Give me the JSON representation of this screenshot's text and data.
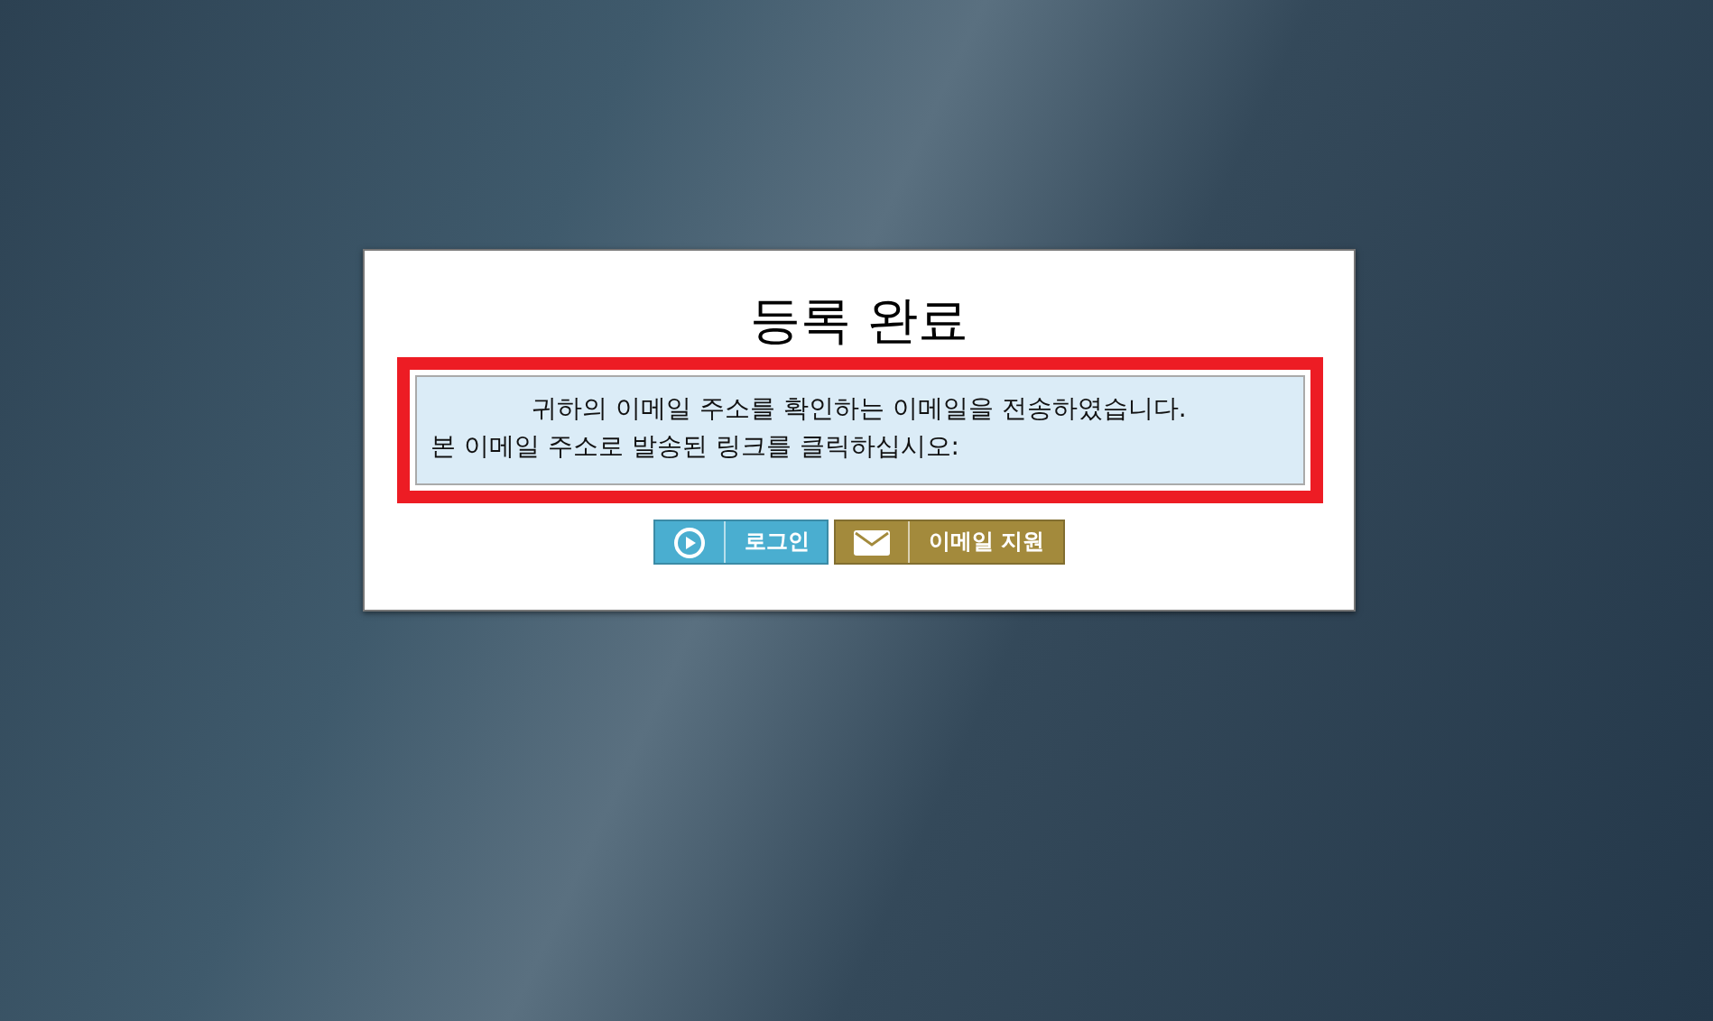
{
  "dialog": {
    "title": "등록 완료",
    "message": [
      "귀하의 이메일 주소를 확인하는 이메일을 전송하였습니다.",
      "본 이메일 주소로 발송된 링크를 클릭하십시오:"
    ],
    "buttons": [
      {
        "kind": "play",
        "label": "로그인"
      },
      {
        "kind": "mail",
        "label": "이메일 지원"
      }
    ]
  }
}
